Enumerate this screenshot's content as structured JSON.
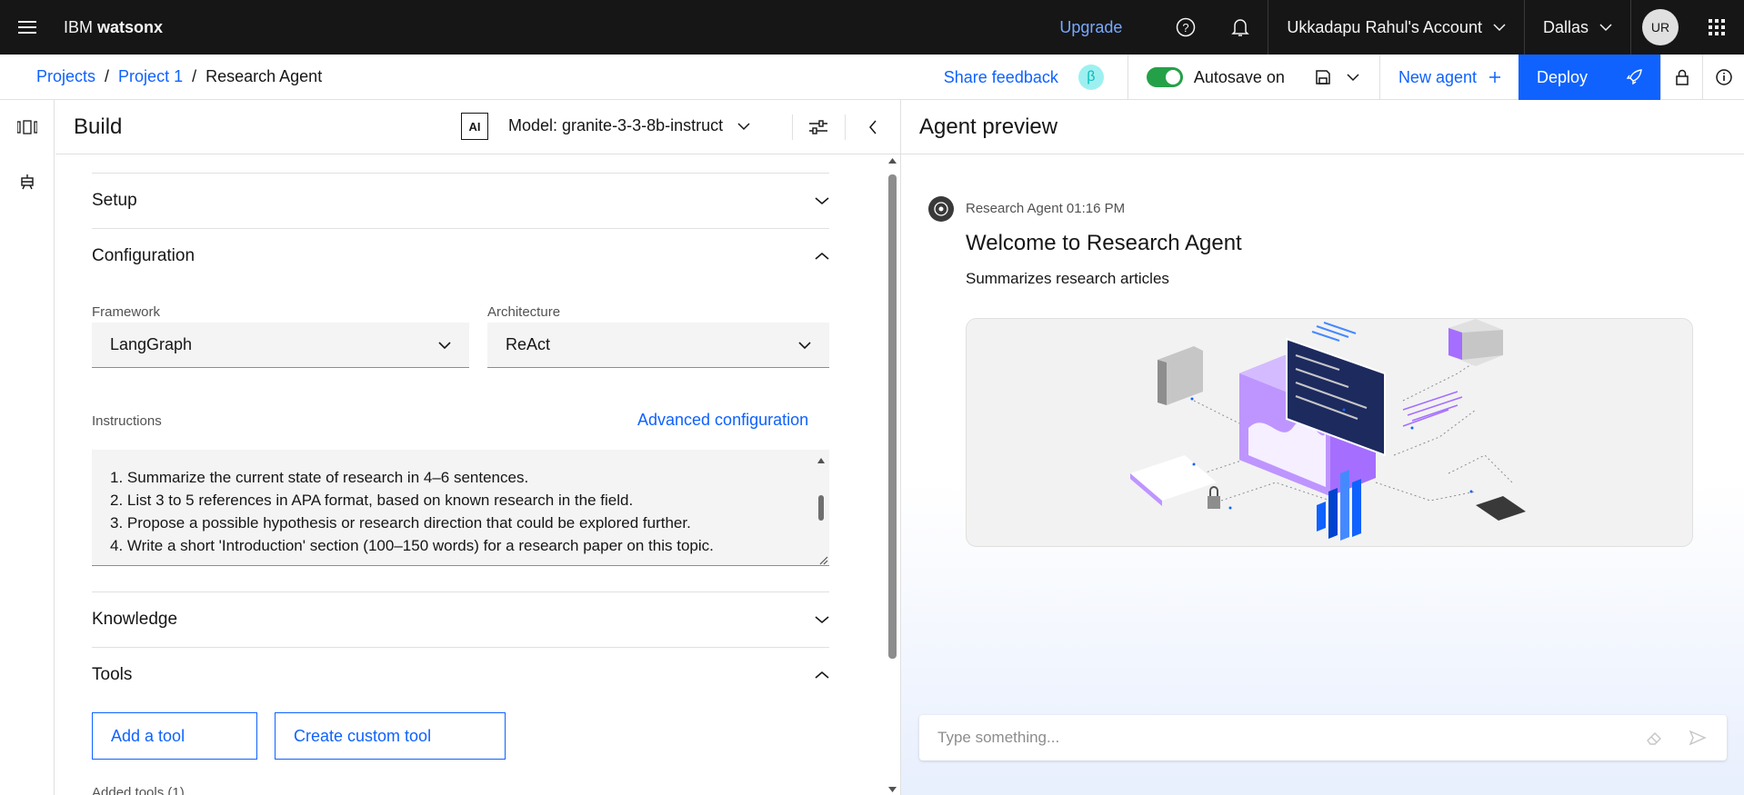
{
  "topbar": {
    "brand_plain": "IBM ",
    "brand_bold": "watsonx",
    "upgrade": "Upgrade",
    "account": "Ukkadapu Rahul's Account",
    "region": "Dallas",
    "avatar": "UR"
  },
  "breadcrumb": {
    "items": [
      "Projects",
      "Project 1",
      "Research Agent"
    ],
    "separator": "/"
  },
  "subbar": {
    "share_feedback": "Share feedback",
    "beta": "β",
    "autosave": "Autosave on",
    "new_agent": "New agent",
    "deploy": "Deploy"
  },
  "build": {
    "title": "Build",
    "ai_badge": "AI",
    "model": "Model: granite-3-3-8b-instruct",
    "sections": {
      "setup": "Setup",
      "configuration": "Configuration",
      "knowledge": "Knowledge",
      "tools": "Tools"
    },
    "framework_label": "Framework",
    "framework_value": "LangGraph",
    "architecture_label": "Architecture",
    "architecture_value": "ReAct",
    "instructions_label": "Instructions",
    "advanced_config": "Advanced configuration",
    "instructions_lines": [
      "1. Summarize the current state of research in 4–6 sentences.",
      "2. List 3 to 5 references in APA format, based on known research in the field.",
      "3. Propose a possible hypothesis or research direction that could be explored further.",
      "4. Write a short 'Introduction' section (100–150 words) for a research paper on this topic."
    ],
    "add_tool": "Add a tool",
    "create_custom_tool": "Create custom tool",
    "added_tools": "Added tools (1)"
  },
  "preview": {
    "title": "Agent preview",
    "sender": "Research Agent 01:16 PM",
    "welcome": "Welcome to Research Agent",
    "summary": "Summarizes research articles",
    "input_placeholder": "Type something..."
  },
  "colors": {
    "accent": "#0f62fe",
    "topbar": "#161616",
    "toggle_on": "#24a148",
    "illustration_purple": "#a56eff"
  }
}
